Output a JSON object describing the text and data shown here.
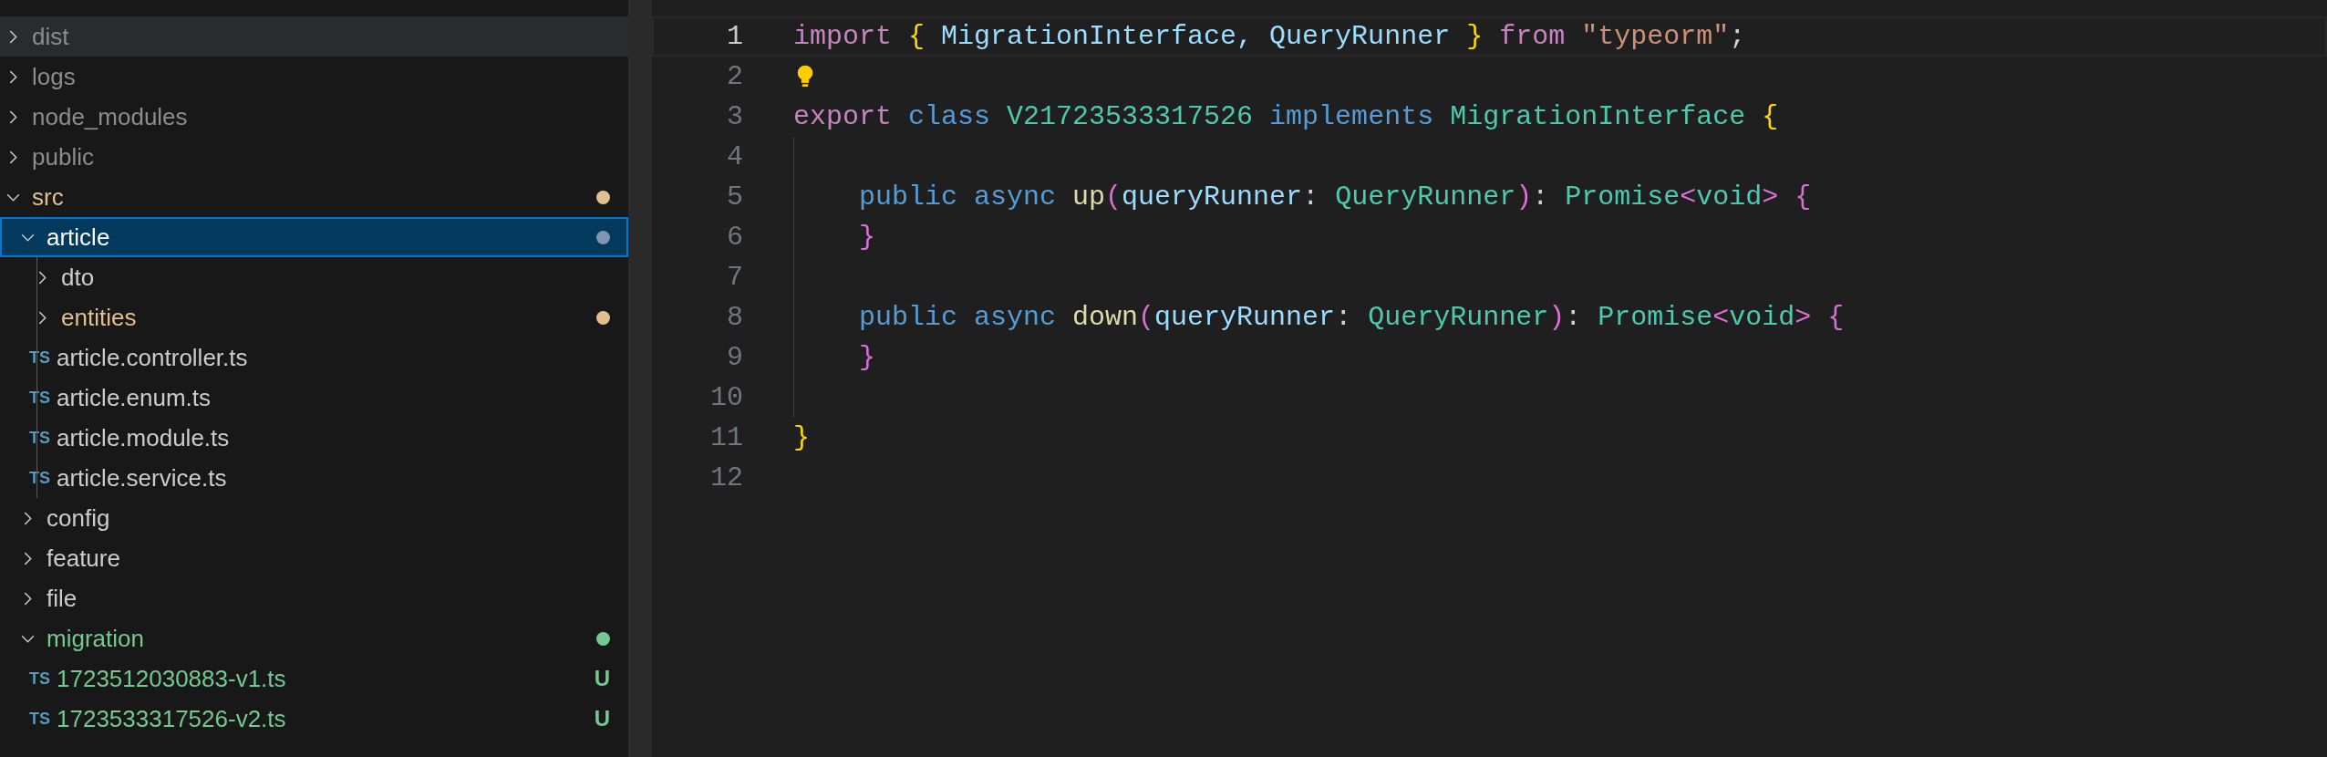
{
  "explorer": {
    "tree": [
      {
        "name": "dist",
        "kind": "folder",
        "expanded": false,
        "ignored": true,
        "hovered": true,
        "selected": false
      },
      {
        "name": "logs",
        "kind": "folder",
        "expanded": false,
        "ignored": true,
        "hovered": false,
        "selected": false
      },
      {
        "name": "node_modules",
        "kind": "folder",
        "expanded": false,
        "ignored": true,
        "hovered": false,
        "selected": false
      },
      {
        "name": "public",
        "kind": "folder",
        "expanded": false,
        "ignored": true,
        "hovered": false,
        "selected": false
      },
      {
        "name": "src",
        "kind": "folder",
        "expanded": true,
        "ignored": false,
        "hovered": false,
        "selected": false,
        "color": "#e2c08d",
        "children": [
          {
            "name": "article",
            "kind": "folder",
            "expanded": true,
            "ignored": false,
            "hovered": false,
            "selected": true,
            "color": "#7f95b2",
            "children": [
              {
                "name": "dto",
                "kind": "folder",
                "expanded": false,
                "ignored": false,
                "hovered": false,
                "selected": false
              },
              {
                "name": "entities",
                "kind": "folder",
                "expanded": false,
                "ignored": false,
                "hovered": false,
                "selected": false,
                "color": "#e2c08d"
              },
              {
                "name": "article.controller.ts",
                "kind": "file",
                "file_icon": "TS",
                "ignored": false,
                "hovered": false,
                "selected": false
              },
              {
                "name": "article.enum.ts",
                "kind": "file",
                "file_icon": "TS",
                "ignored": false,
                "hovered": false,
                "selected": false
              },
              {
                "name": "article.module.ts",
                "kind": "file",
                "file_icon": "TS",
                "ignored": false,
                "hovered": false,
                "selected": false
              },
              {
                "name": "article.service.ts",
                "kind": "file",
                "file_icon": "TS",
                "ignored": false,
                "hovered": false,
                "selected": false
              }
            ]
          },
          {
            "name": "config",
            "kind": "folder",
            "expanded": false,
            "ignored": false,
            "hovered": false,
            "selected": false
          },
          {
            "name": "feature",
            "kind": "folder",
            "expanded": false,
            "ignored": false,
            "hovered": false,
            "selected": false
          },
          {
            "name": "file",
            "kind": "folder",
            "expanded": false,
            "ignored": false,
            "hovered": false,
            "selected": false
          },
          {
            "name": "migration",
            "kind": "folder",
            "expanded": true,
            "ignored": false,
            "hovered": false,
            "selected": false,
            "color": "#73c991",
            "children": [
              {
                "name": "1723512030883-v1.ts",
                "kind": "file",
                "file_icon": "TS",
                "ignored": false,
                "hovered": false,
                "selected": false,
                "color": "#73c991",
                "badge": "U"
              },
              {
                "name": "1723533317526-v2.ts",
                "kind": "file",
                "file_icon": "TS",
                "ignored": false,
                "hovered": false,
                "selected": false,
                "color": "#73c991",
                "badge": "U"
              }
            ]
          }
        ]
      }
    ]
  },
  "editor": {
    "lines": [
      {
        "number": "1",
        "current": true,
        "lightbulb": false,
        "indent_guide": false,
        "tokens": [
          {
            "text": "import ",
            "kind": "keyword"
          },
          {
            "text": "{ ",
            "kind": "bracket"
          },
          {
            "text": "MigrationInterface, QueryRunner ",
            "kind": "variable"
          },
          {
            "text": "} ",
            "kind": "bracket"
          },
          {
            "text": "from ",
            "kind": "keyword"
          },
          {
            "text": "\"typeorm\"",
            "kind": "string"
          },
          {
            "text": ";",
            "kind": "plain"
          }
        ]
      },
      {
        "number": "2",
        "current": false,
        "lightbulb": true,
        "indent_guide": false
      },
      {
        "number": "3",
        "current": false,
        "lightbulb": false,
        "indent_guide": false,
        "tokens": [
          {
            "text": "export ",
            "kind": "keyword"
          },
          {
            "text": "class ",
            "kind": "storage"
          },
          {
            "text": "V21723533317526 ",
            "kind": "type"
          },
          {
            "text": "implements ",
            "kind": "storage"
          },
          {
            "text": "MigrationInterface ",
            "kind": "type"
          },
          {
            "text": "{",
            "kind": "bracket"
          }
        ]
      },
      {
        "number": "4",
        "current": false,
        "lightbulb": false,
        "indent_guide": true
      },
      {
        "number": "5",
        "current": false,
        "lightbulb": false,
        "indent_guide": true,
        "tokens": [
          {
            "text": "    public async ",
            "kind": "storage"
          },
          {
            "text": "up",
            "kind": "function"
          },
          {
            "text": "(",
            "kind": "paren"
          },
          {
            "text": "queryRunner",
            "kind": "variable"
          },
          {
            "text": ": ",
            "kind": "plain"
          },
          {
            "text": "QueryRunner",
            "kind": "type"
          },
          {
            "text": ")",
            "kind": "paren"
          },
          {
            "text": ": ",
            "kind": "plain"
          },
          {
            "text": "Promise",
            "kind": "type"
          },
          {
            "text": "<",
            "kind": "paren"
          },
          {
            "text": "void",
            "kind": "type"
          },
          {
            "text": "> {",
            "kind": "paren"
          }
        ]
      },
      {
        "number": "6",
        "current": false,
        "lightbulb": false,
        "indent_guide": true,
        "tokens": [
          {
            "text": "    }",
            "kind": "paren"
          }
        ]
      },
      {
        "number": "7",
        "current": false,
        "lightbulb": false,
        "indent_guide": true
      },
      {
        "number": "8",
        "current": false,
        "lightbulb": false,
        "indent_guide": true,
        "tokens": [
          {
            "text": "    public async ",
            "kind": "storage"
          },
          {
            "text": "down",
            "kind": "function"
          },
          {
            "text": "(",
            "kind": "paren"
          },
          {
            "text": "queryRunner",
            "kind": "variable"
          },
          {
            "text": ": ",
            "kind": "plain"
          },
          {
            "text": "QueryRunner",
            "kind": "type"
          },
          {
            "text": ")",
            "kind": "paren"
          },
          {
            "text": ": ",
            "kind": "plain"
          },
          {
            "text": "Promise",
            "kind": "type"
          },
          {
            "text": "<",
            "kind": "paren"
          },
          {
            "text": "void",
            "kind": "type"
          },
          {
            "text": "> {",
            "kind": "paren"
          }
        ]
      },
      {
        "number": "9",
        "current": false,
        "lightbulb": false,
        "indent_guide": true,
        "tokens": [
          {
            "text": "    }",
            "kind": "paren"
          }
        ]
      },
      {
        "number": "10",
        "current": false,
        "lightbulb": false,
        "indent_guide": true
      },
      {
        "number": "11",
        "current": false,
        "lightbulb": false,
        "indent_guide": false,
        "tokens": [
          {
            "text": "}",
            "kind": "bracket"
          }
        ]
      },
      {
        "number": "12",
        "current": false,
        "lightbulb": false,
        "indent_guide": false
      }
    ]
  }
}
